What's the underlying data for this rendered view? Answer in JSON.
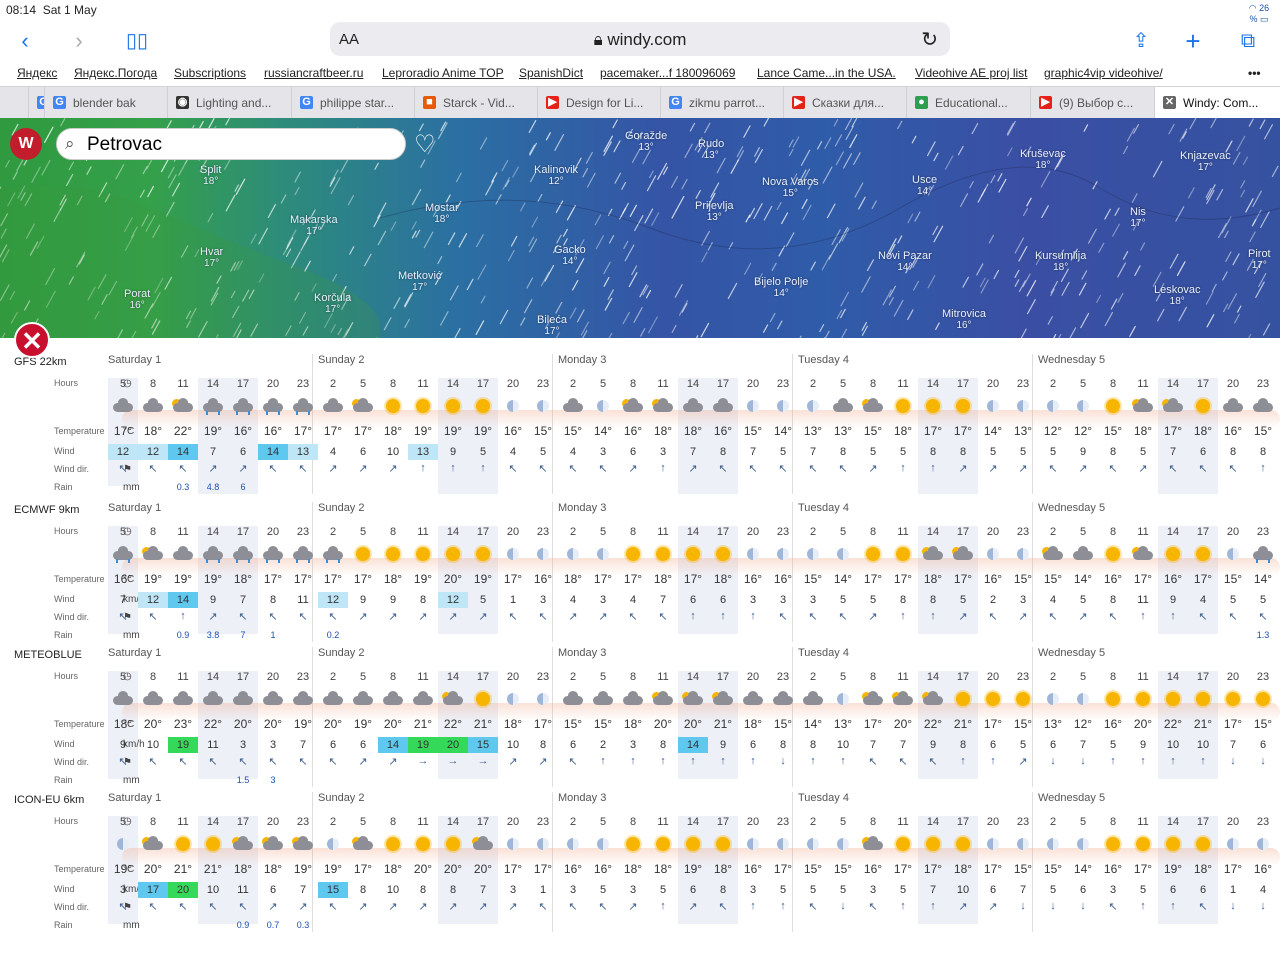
{
  "status": {
    "time": "08:14",
    "date": "Sat 1 May",
    "battery": "26 %"
  },
  "toolbar": {
    "aa": "AA",
    "url": "windy.com",
    "back_icon": "‹",
    "fwd_icon": "›"
  },
  "bookmarks": [
    "Яндекс",
    "Яндекс.Погода",
    "Subscriptions",
    "russiancraftbeer.ru",
    "Leproradio Anime TOP",
    "SpanishDict",
    "pacemaker...f 180096069",
    "Lance Came...in the USA.",
    "Videohive AE proj list",
    "graphic4vip videohive/"
  ],
  "tabs": [
    {
      "label": "",
      "icon": "G"
    },
    {
      "label": "blender bak",
      "icon": "G"
    },
    {
      "label": "Lighting and...",
      "icon": "◉"
    },
    {
      "label": "philippe star...",
      "icon": "G"
    },
    {
      "label": "Starck - Vid...",
      "icon": "■"
    },
    {
      "label": "Design for Li...",
      "icon": "▶"
    },
    {
      "label": "zikmu parrot...",
      "icon": "G"
    },
    {
      "label": "Сказки для...",
      "icon": "▶"
    },
    {
      "label": "Educational...",
      "icon": "●"
    },
    {
      "label": "(9) Выбор с...",
      "icon": "▶"
    },
    {
      "label": "Windy: Com...",
      "icon": "✕"
    }
  ],
  "search": {
    "value": "Petrovac"
  },
  "cities": [
    {
      "n": "Split",
      "t": "18°"
    },
    {
      "n": "Makarska",
      "t": "17°"
    },
    {
      "n": "Hvar",
      "t": "17°"
    },
    {
      "n": "Mostar",
      "t": "18°"
    },
    {
      "n": "Metković",
      "t": "17°"
    },
    {
      "n": "Korčula",
      "t": "17°"
    },
    {
      "n": "Porat",
      "t": "16°"
    },
    {
      "n": "Gacko",
      "t": "14°"
    },
    {
      "n": "Bileća",
      "t": "17°"
    },
    {
      "n": "Kalinovik",
      "t": "12°"
    },
    {
      "n": "Goražde",
      "t": "13°"
    },
    {
      "n": "Rudo",
      "t": "13°"
    },
    {
      "n": "Nova Varos",
      "t": "15°"
    },
    {
      "n": "Prijevlja",
      "t": "13°"
    },
    {
      "n": "Bijelo Polje",
      "t": "14°"
    },
    {
      "n": "Usce",
      "t": "14°"
    },
    {
      "n": "Novi Pazar",
      "t": "14°"
    },
    {
      "n": "Kruševac",
      "t": "18°"
    },
    {
      "n": "Knjazevac",
      "t": "17°"
    },
    {
      "n": "Nis",
      "t": "17°"
    },
    {
      "n": "Kursumlija",
      "t": "18°"
    },
    {
      "n": "Leskovac",
      "t": "18°"
    },
    {
      "n": "Pirot",
      "t": "17°"
    },
    {
      "n": "Mitrovica",
      "t": "16°"
    }
  ],
  "labels": {
    "hours": "Hours",
    "temperature": "Temperature",
    "temp_unit": "°C",
    "wind": "Wind",
    "wind_unit": "km/h",
    "winddir": "Wind dir.",
    "rain": "Rain",
    "rain_unit": "mm"
  },
  "days": [
    "Saturday 1",
    "Sunday 2",
    "Monday 3",
    "Tuesday 4",
    "Wednesday 5"
  ],
  "hours": [
    "5",
    "8",
    "11",
    "14",
    "17",
    "20",
    "23",
    "2",
    "5",
    "8",
    "11",
    "14",
    "17",
    "20",
    "23",
    "2",
    "5",
    "8",
    "11",
    "14",
    "17",
    "20",
    "23",
    "2",
    "5",
    "8",
    "11",
    "14",
    "17",
    "20",
    "23",
    "2",
    "5",
    "8",
    "11",
    "14",
    "17",
    "20",
    "23"
  ],
  "models": [
    {
      "name": "GFS 22km",
      "icons": [
        "c",
        "c",
        "ps",
        "r",
        "r",
        "r",
        "r",
        "c",
        "ps",
        "s",
        "s",
        "s",
        "s",
        "m",
        "m",
        "c",
        "m",
        "ps",
        "ps",
        "c",
        "c",
        "m",
        "m",
        "m",
        "c",
        "ps",
        "s",
        "s",
        "s",
        "m",
        "m",
        "m",
        "m",
        "s",
        "ps",
        "ps",
        "s",
        "c",
        "c"
      ],
      "temps": [
        "17°",
        "18°",
        "22°",
        "19°",
        "16°",
        "16°",
        "17°",
        "17°",
        "17°",
        "18°",
        "19°",
        "19°",
        "19°",
        "16°",
        "15°",
        "15°",
        "14°",
        "16°",
        "18°",
        "18°",
        "16°",
        "15°",
        "14°",
        "13°",
        "13°",
        "15°",
        "18°",
        "17°",
        "17°",
        "14°",
        "13°",
        "12°",
        "12°",
        "15°",
        "18°",
        "17°",
        "18°",
        "16°",
        "15°"
      ],
      "wind": [
        "12",
        "12",
        "14",
        "7",
        "6",
        "14",
        "13",
        "4",
        "6",
        "10",
        "13",
        "9",
        "5",
        "4",
        "5",
        "4",
        "3",
        "6",
        "3",
        "7",
        "8",
        "7",
        "5",
        "7",
        "8",
        "5",
        "5",
        "8",
        "8",
        "5",
        "5",
        "5",
        "9",
        "8",
        "5",
        "7",
        "6",
        "8",
        "8"
      ],
      "dir": [
        "↖",
        "↖",
        "↖",
        "↗",
        "↗",
        "↖",
        "↖",
        "↗",
        "↗",
        "↗",
        "↑",
        "↑",
        "↑",
        "↖",
        "↖",
        "↖",
        "↖",
        "↗",
        "↑",
        "↗",
        "↖",
        "↖",
        "↖",
        "↖",
        "↖",
        "↗",
        "↑",
        "↑",
        "↗",
        "↗",
        "↗",
        "↖",
        "↗",
        "↖",
        "↗",
        "↖",
        "↖",
        "↖",
        "↑"
      ],
      "rain": [
        "",
        "",
        "0.3",
        "4.8",
        "6",
        "",
        "",
        "",
        "",
        "",
        "",
        "",
        "",
        "",
        "",
        "",
        "",
        "",
        "",
        "",
        "",
        "",
        "",
        "",
        "",
        "",
        "",
        "",
        "",
        "",
        "",
        "",
        "",
        "",
        "",
        "",
        "",
        "",
        ""
      ]
    },
    {
      "name": "ECMWF 9km",
      "icons": [
        "r",
        "ps",
        "c",
        "r",
        "r",
        "r",
        "r",
        "r",
        "s",
        "s",
        "s",
        "s",
        "s",
        "m",
        "m",
        "m",
        "m",
        "s",
        "s",
        "s",
        "s",
        "m",
        "m",
        "m",
        "m",
        "s",
        "s",
        "ps",
        "ps",
        "m",
        "m",
        "ps",
        "c",
        "s",
        "ps",
        "s",
        "s",
        "m",
        "r"
      ],
      "temps": [
        "16°",
        "19°",
        "19°",
        "19°",
        "18°",
        "17°",
        "17°",
        "17°",
        "17°",
        "18°",
        "19°",
        "20°",
        "19°",
        "17°",
        "16°",
        "18°",
        "17°",
        "17°",
        "18°",
        "17°",
        "18°",
        "16°",
        "16°",
        "15°",
        "14°",
        "17°",
        "17°",
        "18°",
        "17°",
        "16°",
        "15°",
        "15°",
        "14°",
        "16°",
        "17°",
        "16°",
        "17°",
        "15°",
        "14°"
      ],
      "wind": [
        "7",
        "12",
        "14",
        "9",
        "7",
        "8",
        "11",
        "12",
        "9",
        "9",
        "8",
        "12",
        "5",
        "1",
        "3",
        "4",
        "3",
        "4",
        "7",
        "6",
        "6",
        "3",
        "3",
        "3",
        "5",
        "5",
        "8",
        "8",
        "5",
        "2",
        "3",
        "4",
        "5",
        "8",
        "11",
        "9",
        "4",
        "5",
        "5"
      ],
      "dir": [
        "↖",
        "↖",
        "↑",
        "↗",
        "↖",
        "↖",
        "↖",
        "↖",
        "↗",
        "↗",
        "↗",
        "↗",
        "↗",
        "↖",
        "↖",
        "↗",
        "↗",
        "↖",
        "↖",
        "↑",
        "↑",
        "↑",
        "↖",
        "↖",
        "↖",
        "↗",
        "↑",
        "↑",
        "↗",
        "↖",
        "↗",
        "↖",
        "↗",
        "↖",
        "↑",
        "↑",
        "↖",
        "↖",
        "↖"
      ],
      "rain": [
        "",
        "",
        "0.9",
        "3.8",
        "7",
        "1",
        "",
        "0.2",
        "",
        "",
        "",
        "",
        "",
        "",
        "",
        "",
        "",
        "",
        "",
        "",
        "",
        "",
        "",
        "",
        "",
        "",
        "",
        "",
        "",
        "",
        "",
        "",
        "",
        "",
        "",
        "",
        "",
        "",
        "1.3"
      ]
    },
    {
      "name": "METEOBLUE",
      "icons": [
        "c",
        "c",
        "c",
        "c",
        "c",
        "c",
        "c",
        "c",
        "c",
        "c",
        "c",
        "ps",
        "s",
        "m",
        "m",
        "c",
        "c",
        "c",
        "ps",
        "ps",
        "ps",
        "c",
        "c",
        "c",
        "m",
        "ps",
        "ps",
        "ps",
        "s",
        "s",
        "s",
        "m",
        "m",
        "s",
        "s",
        "s",
        "s",
        "s",
        "s"
      ],
      "temps": [
        "18°",
        "20°",
        "23°",
        "22°",
        "20°",
        "20°",
        "19°",
        "20°",
        "19°",
        "20°",
        "21°",
        "22°",
        "21°",
        "18°",
        "17°",
        "15°",
        "15°",
        "18°",
        "20°",
        "20°",
        "21°",
        "18°",
        "15°",
        "14°",
        "13°",
        "17°",
        "20°",
        "22°",
        "21°",
        "17°",
        "15°",
        "13°",
        "12°",
        "16°",
        "20°",
        "22°",
        "21°",
        "17°",
        "15°"
      ],
      "wind": [
        "9",
        "10",
        "19",
        "11",
        "3",
        "3",
        "7",
        "6",
        "6",
        "14",
        "19",
        "20",
        "15",
        "10",
        "8",
        "6",
        "2",
        "3",
        "8",
        "14",
        "9",
        "6",
        "8",
        "8",
        "10",
        "7",
        "7",
        "9",
        "8",
        "6",
        "5",
        "6",
        "7",
        "5",
        "9",
        "10",
        "10",
        "7",
        "6"
      ],
      "dir": [
        "↖",
        "↖",
        "↖",
        "↖",
        "↖",
        "↖",
        "↖",
        "↖",
        "↗",
        "↗",
        "→",
        "→",
        "→",
        "↗",
        "↗",
        "↖",
        "↑",
        "↑",
        "↑",
        "↑",
        "↑",
        "↑",
        "↓",
        "↑",
        "↑",
        "↖",
        "↖",
        "↖",
        "↑",
        "↑",
        "↗",
        "↓",
        "↓",
        "↑",
        "↑",
        "↑",
        "↑",
        "↓",
        "↓"
      ],
      "rain": [
        "",
        "",
        "",
        "",
        "1.5",
        "3",
        "",
        "",
        "",
        "",
        "",
        "",
        "",
        "",
        "",
        "",
        "",
        "",
        "",
        "",
        "",
        "",
        "",
        "",
        "",
        "",
        "",
        "",
        "",
        "",
        "",
        "",
        "",
        "",
        "",
        "",
        "",
        "",
        ""
      ]
    },
    {
      "name": "ICON-EU 6km",
      "icons": [
        "m",
        "ps",
        "s",
        "s",
        "ps",
        "ps",
        "ps",
        "m",
        "ps",
        "s",
        "s",
        "s",
        "ps",
        "m",
        "m",
        "m",
        "m",
        "s",
        "s",
        "s",
        "s",
        "m",
        "m",
        "m",
        "m",
        "ps",
        "s",
        "s",
        "s",
        "m",
        "m",
        "m",
        "m",
        "s",
        "s",
        "s",
        "s",
        "m",
        "m"
      ],
      "temps": [
        "19°",
        "20°",
        "21°",
        "21°",
        "18°",
        "18°",
        "19°",
        "19°",
        "17°",
        "18°",
        "20°",
        "20°",
        "20°",
        "17°",
        "17°",
        "16°",
        "16°",
        "18°",
        "18°",
        "19°",
        "18°",
        "16°",
        "17°",
        "15°",
        "15°",
        "16°",
        "17°",
        "17°",
        "18°",
        "17°",
        "15°",
        "15°",
        "14°",
        "16°",
        "17°",
        "19°",
        "18°",
        "17°",
        "16°"
      ],
      "wind": [
        "3",
        "17",
        "20",
        "10",
        "11",
        "6",
        "7",
        "15",
        "8",
        "10",
        "8",
        "8",
        "7",
        "3",
        "1",
        "3",
        "5",
        "3",
        "5",
        "6",
        "8",
        "3",
        "5",
        "5",
        "5",
        "3",
        "5",
        "7",
        "10",
        "6",
        "7",
        "5",
        "6",
        "3",
        "5",
        "6",
        "6",
        "1",
        "4"
      ],
      "dir": [
        "↖",
        "↖",
        "↖",
        "↖",
        "↖",
        "↗",
        "↗",
        "↖",
        "↗",
        "↗",
        "↗",
        "↗",
        "↗",
        "↗",
        "↖",
        "↖",
        "↖",
        "↗",
        "↑",
        "↗",
        "↖",
        "↑",
        "↑",
        "↖",
        "↓",
        "↖",
        "↑",
        "↑",
        "↗",
        "↗",
        "↓",
        "↓",
        "↓",
        "↖",
        "↑",
        "↑",
        "↖",
        "↓",
        "↓"
      ],
      "rain": [
        "",
        "",
        "",
        "",
        "0.9",
        "0.7",
        "0.3",
        "",
        "",
        "",
        "",
        "",
        "",
        "",
        "",
        "",
        "",
        "",
        "",
        "",
        "",
        "",
        "",
        "",
        "",
        "",
        "",
        "",
        "",
        "",
        "",
        "",
        "",
        "",
        "",
        "",
        "",
        "",
        ""
      ]
    }
  ]
}
